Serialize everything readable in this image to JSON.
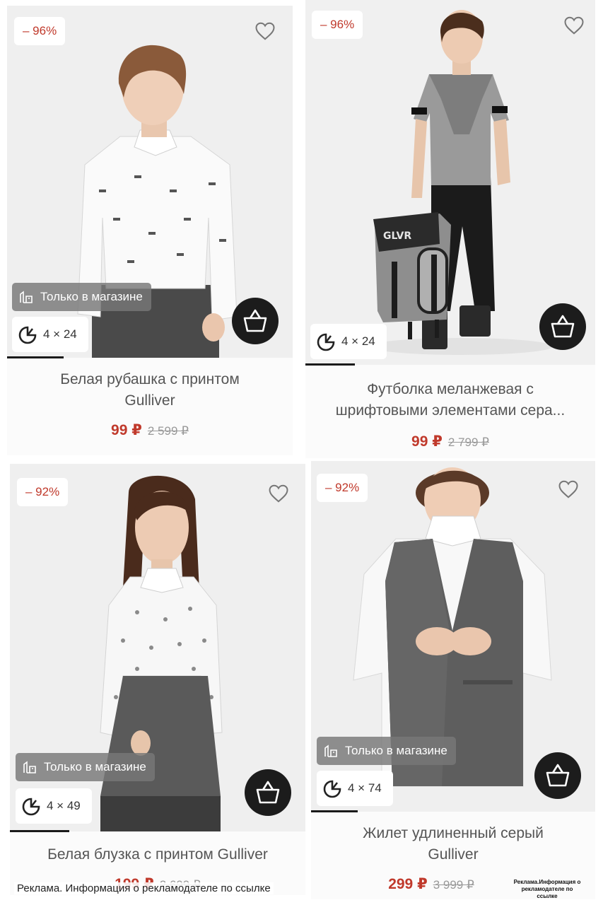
{
  "products": [
    {
      "discount": "– 96%",
      "title_line1": "Белая рубашка с принтом",
      "title_line2": "Gulliver",
      "price_new": "99 ₽",
      "price_old": "2 599 ₽",
      "store_badge": "Только в магазине",
      "installment": "4 × 24"
    },
    {
      "discount": "– 96%",
      "title_line1": "Футболка меланжевая с",
      "title_line2": "шрифтовыми элементами сера...",
      "price_new": "99 ₽",
      "price_old": "2 799 ₽",
      "installment": "4 × 24"
    },
    {
      "discount": "– 92%",
      "title_line1": "Белая блузка с принтом Gulliver",
      "price_new": "199 ₽",
      "price_old": "2 699 ₽",
      "store_badge": "Только в магазине",
      "installment": "4 × 49"
    },
    {
      "discount": "– 92%",
      "title_line1": "Жилет удлиненный серый",
      "title_line2": "Gulliver",
      "price_new": "299 ₽",
      "price_old": "3 999 ₽",
      "store_badge": "Только в магазине",
      "installment": "4 × 74"
    }
  ],
  "ad": {
    "text": "Реклама. Информация о рекламодателе по ссылке",
    "mini": "Реклама.Информация о рекламодателе по ссылке"
  },
  "colors": {
    "accent_price": "#c0392b",
    "cart_button": "#1c1c1c",
    "badge_bg": "#7a7a7a"
  },
  "icons": [
    "heart-icon",
    "store-icon",
    "installment-icon",
    "basket-icon"
  ]
}
